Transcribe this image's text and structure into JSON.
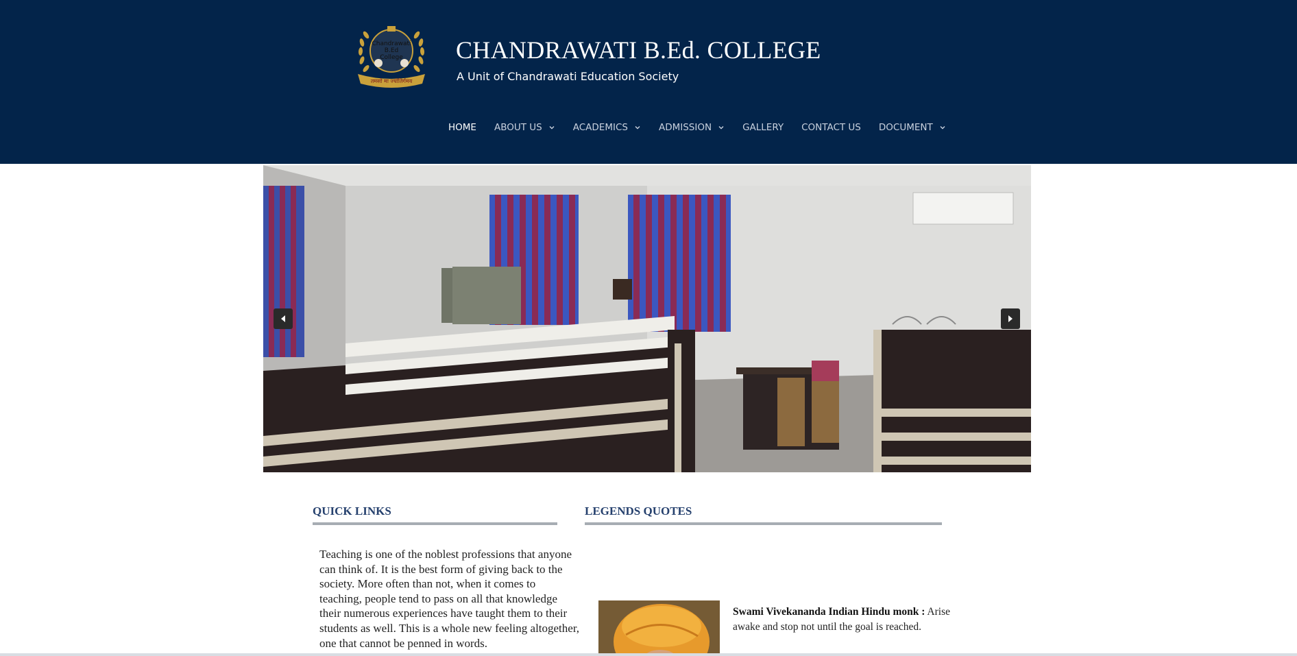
{
  "header": {
    "title": "CHANDRAWATI B.Ed. COLLEGE",
    "subtitle": "A Unit of Chandrawati Education Society",
    "logo": {
      "text_lines": [
        "Chandrawati",
        "B.Ed",
        "College"
      ],
      "motto": "तमसो मा ज्योतिर्गमय"
    }
  },
  "nav": {
    "items": [
      {
        "label": "HOME",
        "active": true,
        "dropdown": false
      },
      {
        "label": "ABOUT US",
        "active": false,
        "dropdown": true
      },
      {
        "label": "ACADEMICS",
        "active": false,
        "dropdown": true
      },
      {
        "label": "ADMISSION",
        "active": false,
        "dropdown": true
      },
      {
        "label": "GALLERY",
        "active": false,
        "dropdown": false
      },
      {
        "label": "CONTACT US",
        "active": false,
        "dropdown": false
      },
      {
        "label": "DOCUMENT",
        "active": false,
        "dropdown": true
      }
    ]
  },
  "slider": {
    "prev_icon": "triangle-left-icon",
    "next_icon": "triangle-right-icon"
  },
  "quick_links": {
    "heading": "QUICK LINKS",
    "text": "Teaching is one of the noblest professions that anyone can think of. It is the best form of giving back to the society. More often than not, when it comes to teaching, people tend to pass on all that knowledge their numerous experiences have taught them to their students as well. This is a whole new feeling altogether, one that cannot be penned in words."
  },
  "legends": {
    "heading": "LEGENDS QUOTES",
    "quote_author": "Swami Vivekananda Indian Hindu monk :",
    "quote_text": " Arise awake and stop not until the goal is reached."
  },
  "colors": {
    "header_bg": "#03244a",
    "heading_text": "#26416e",
    "rule": "#a7adb3",
    "logo_gold": "#c9a13b"
  }
}
